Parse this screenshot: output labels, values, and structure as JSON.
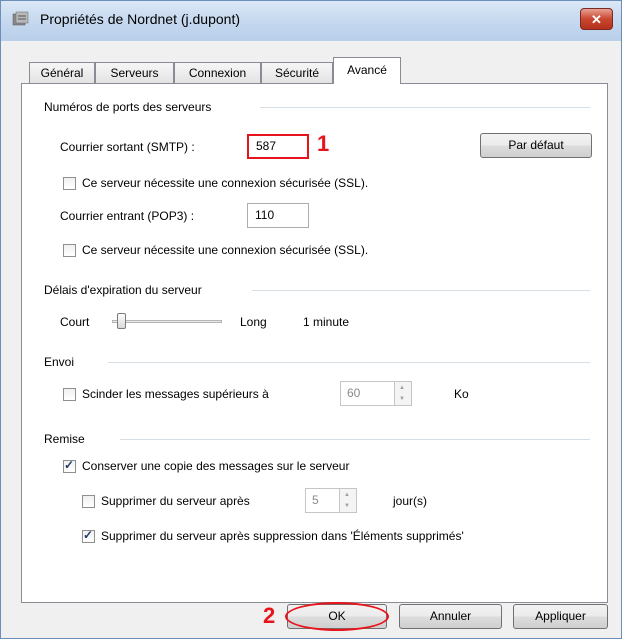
{
  "window": {
    "title": "Propriétés de Nordnet (j.dupont)",
    "close_symbol": "✕"
  },
  "tabs": [
    "Général",
    "Serveurs",
    "Connexion",
    "Sécurité",
    "Avancé"
  ],
  "active_tab": "Avancé",
  "ports": {
    "section_title": "Numéros de ports des serveurs",
    "smtp_label": "Courrier sortant (SMTP) :",
    "smtp_value": "587",
    "smtp_ssl_label": "Ce serveur nécessite une connexion sécurisée (SSL).",
    "pop3_label": "Courrier entrant (POP3) :",
    "pop3_value": "110",
    "pop3_ssl_label": "Ce serveur nécessite une connexion sécurisée (SSL).",
    "default_button": "Par défaut"
  },
  "timeout": {
    "section_title": "Délais d'expiration du serveur",
    "short_label": "Court",
    "long_label": "Long",
    "value_label": "1 minute",
    "slider_level": 0.05
  },
  "send": {
    "section_title": "Envoi",
    "split_label": "Scinder les messages supérieurs à",
    "split_value": "60",
    "unit": "Ko",
    "split_checked": false
  },
  "delivery": {
    "section_title": "Remise",
    "keep_copy_label": "Conserver une copie des messages sur le serveur",
    "keep_copy_checked": true,
    "delete_after_label": "Supprimer du serveur après",
    "delete_after_value": "5",
    "delete_after_unit": "jour(s)",
    "delete_after_checked": false,
    "delete_deleted_label": "Supprimer du serveur après suppression dans 'Éléments supprimés'",
    "delete_deleted_checked": true
  },
  "footer": {
    "ok": "OK",
    "cancel": "Annuler",
    "apply": "Appliquer"
  },
  "annotations": {
    "step1": "1",
    "step2": "2",
    "color": "#e8141b"
  },
  "colors": {
    "accent": "#3c7fb1",
    "close_button": "#c9472f"
  }
}
